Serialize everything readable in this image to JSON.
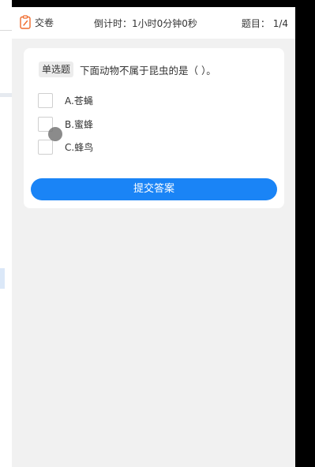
{
  "topbar": {
    "submit_label": "交卷",
    "countdown": "倒计时：1小时0分钟0秒",
    "progress_label": "题目：",
    "progress_value": "1/4"
  },
  "question": {
    "type_badge": "单选题",
    "text": "下面动物不属于昆虫的是（ ）。",
    "options": [
      {
        "label": "A.苍蝇"
      },
      {
        "label": "B.蜜蜂"
      },
      {
        "label": "C.蜂鸟"
      }
    ]
  },
  "answer_button": "提交答案",
  "icons": {
    "submit": "clipboard-pen-icon"
  },
  "colors": {
    "accent": "#1a84f6",
    "icon_accent": "#f06a2b",
    "page_bg": "#f1f1f1"
  }
}
